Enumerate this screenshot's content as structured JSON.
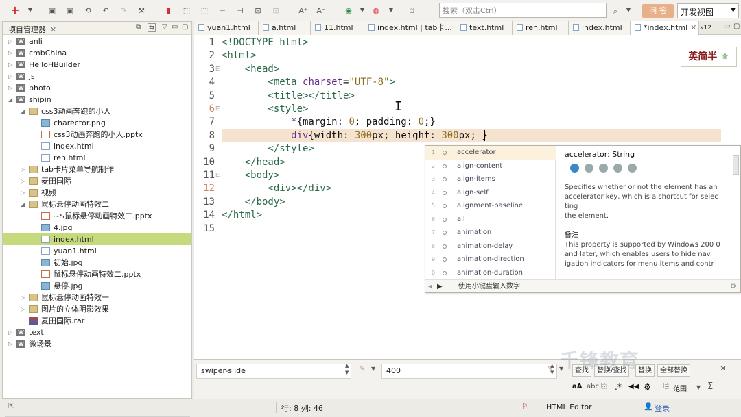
{
  "toolbar": {
    "search_placeholder": "搜索（双击Ctrl）",
    "ask_label": "问 答",
    "view_label": "开发视图"
  },
  "project_panel": {
    "title": "项目管理器",
    "tree": [
      {
        "label": "anli",
        "depth": 0,
        "icon": "web-project-icon",
        "twisty": "closed"
      },
      {
        "label": "cmbChina",
        "depth": 0,
        "icon": "web-project-icon",
        "twisty": "closed"
      },
      {
        "label": "HelloHBuilder",
        "depth": 0,
        "icon": "web-project-icon",
        "twisty": "closed"
      },
      {
        "label": "js",
        "depth": 0,
        "icon": "web-project-icon",
        "twisty": "closed"
      },
      {
        "label": "photo",
        "depth": 0,
        "icon": "web-project-icon",
        "twisty": "closed"
      },
      {
        "label": "shipin",
        "depth": 0,
        "icon": "web-project-icon",
        "twisty": "open"
      },
      {
        "label": "css3动画奔跑的小人",
        "depth": 1,
        "icon": "folder-icon",
        "twisty": "open"
      },
      {
        "label": "charector.png",
        "depth": 2,
        "icon": "image-file-icon",
        "twisty": ""
      },
      {
        "label": "css3动画奔跑的小人.pptx",
        "depth": 2,
        "icon": "pptx-file-icon",
        "twisty": ""
      },
      {
        "label": "index.html",
        "depth": 2,
        "icon": "html-file-icon",
        "twisty": ""
      },
      {
        "label": "ren.html",
        "depth": 2,
        "icon": "html-file-icon",
        "twisty": ""
      },
      {
        "label": "tab卡片菜单导航制作",
        "depth": 1,
        "icon": "folder-icon",
        "twisty": "closed"
      },
      {
        "label": "麦田国际",
        "depth": 1,
        "icon": "folder-icon",
        "twisty": "closed"
      },
      {
        "label": "视频",
        "depth": 1,
        "icon": "folder-icon",
        "twisty": "closed"
      },
      {
        "label": "鼠标悬停动画特效二",
        "depth": 1,
        "icon": "folder-icon",
        "twisty": "open"
      },
      {
        "label": "~$鼠标悬停动画特效二.pptx",
        "depth": 2,
        "icon": "pptx-file-icon",
        "twisty": ""
      },
      {
        "label": "4.jpg",
        "depth": 2,
        "icon": "image-file-icon",
        "twisty": ""
      },
      {
        "label": "index.html",
        "depth": 2,
        "icon": "html-file-icon",
        "twisty": "",
        "selected": true
      },
      {
        "label": "yuan1.html",
        "depth": 2,
        "icon": "html-file-icon",
        "twisty": ""
      },
      {
        "label": "初始.jpg",
        "depth": 2,
        "icon": "image-file-icon",
        "twisty": ""
      },
      {
        "label": "鼠标悬停动画特效二.pptx",
        "depth": 2,
        "icon": "pptx-file-icon",
        "twisty": ""
      },
      {
        "label": "悬停.jpg",
        "depth": 2,
        "icon": "image-file-icon",
        "twisty": ""
      },
      {
        "label": "鼠标悬停动画特效一",
        "depth": 1,
        "icon": "folder-icon",
        "twisty": "closed"
      },
      {
        "label": "图片的立体阴影效果",
        "depth": 1,
        "icon": "folder-icon",
        "twisty": "closed"
      },
      {
        "label": "麦田国际.rar",
        "depth": 1,
        "icon": "rar-file-icon",
        "twisty": ""
      },
      {
        "label": "text",
        "depth": 0,
        "icon": "web-project-icon",
        "twisty": "closed"
      },
      {
        "label": "微场景",
        "depth": 0,
        "icon": "web-project-icon",
        "twisty": "closed"
      }
    ]
  },
  "tabs": [
    {
      "label": "yuan1.html"
    },
    {
      "label": "a.html"
    },
    {
      "label": "11.html"
    },
    {
      "label": "index.html | tab卡..."
    },
    {
      "label": "text.html"
    },
    {
      "label": "ren.html"
    },
    {
      "label": "index.html"
    },
    {
      "label": "*index.html",
      "close": "✕",
      "active": true
    }
  ],
  "tabs_overflow": "»12",
  "editor": {
    "line_numbers": [
      "1",
      "2",
      "3",
      "4",
      "5",
      "6",
      "7",
      "8",
      "9",
      "10",
      "11",
      "12",
      "13",
      "14",
      "15"
    ],
    "lines": [
      [
        {
          "t": "<!DOCTYPE html>",
          "c": "t-tag"
        }
      ],
      [
        {
          "t": "<html>",
          "c": "t-tag"
        }
      ],
      [
        {
          "t": "    <head>",
          "c": "t-tag"
        }
      ],
      [
        {
          "t": "        <meta ",
          "c": "t-tag"
        },
        {
          "t": "charset",
          "c": "t-attr"
        },
        {
          "t": "=",
          "c": "t-prop"
        },
        {
          "t": "\"UTF-8\"",
          "c": "t-str"
        },
        {
          "t": ">",
          "c": "t-tag"
        }
      ],
      [
        {
          "t": "        <title></title>",
          "c": "t-tag"
        }
      ],
      [
        {
          "t": "        <style>",
          "c": "t-tag"
        }
      ],
      [
        {
          "t": "            *",
          "c": "t-sel"
        },
        {
          "t": "{margin: ",
          "c": "t-prop"
        },
        {
          "t": "0",
          "c": "t-num"
        },
        {
          "t": "; padding: ",
          "c": "t-prop"
        },
        {
          "t": "0",
          "c": "t-num"
        },
        {
          "t": ";}",
          "c": "t-prop"
        }
      ],
      [
        {
          "t": "            div",
          "c": "t-sel"
        },
        {
          "t": "{width: ",
          "c": "t-prop"
        },
        {
          "t": "300",
          "c": "t-num"
        },
        {
          "t": "px; height: ",
          "c": "t-prop"
        },
        {
          "t": "300",
          "c": "t-num"
        },
        {
          "t": "px; }",
          "c": "t-prop"
        }
      ],
      [
        {
          "t": "        </style>",
          "c": "t-tag"
        }
      ],
      [
        {
          "t": "    </head>",
          "c": "t-tag"
        }
      ],
      [
        {
          "t": "    <body>",
          "c": "t-tag"
        }
      ],
      [
        {
          "t": "        <div></div>",
          "c": "t-tag"
        }
      ],
      [
        {
          "t": "    </body>",
          "c": "t-tag"
        }
      ],
      [
        {
          "t": "</html>",
          "c": "t-tag"
        }
      ],
      []
    ]
  },
  "brand_logo": "英简半",
  "autocomplete": {
    "items": [
      {
        "n": "1",
        "label": "accelerator",
        "selected": true
      },
      {
        "n": "2",
        "label": "align-content"
      },
      {
        "n": "3",
        "label": "align-items"
      },
      {
        "n": "4",
        "label": "align-self"
      },
      {
        "n": "5",
        "label": "alignment-baseline"
      },
      {
        "n": "6",
        "label": "all"
      },
      {
        "n": "7",
        "label": "animation"
      },
      {
        "n": "8",
        "label": "animation-delay"
      },
      {
        "n": "9",
        "label": "animation-direction"
      },
      {
        "n": "0",
        "label": "animation-duration"
      }
    ],
    "doc_title": "accelerator: String",
    "doc_body_1": "Specifies whether or not the element has an accelerator key, which is a shortcut for selec ting",
    "doc_body_2": "the element.",
    "note_title": "备注",
    "note_body": "This property is supported by Windows 200 0 and later, which enables users to hide nav igation indicators for menu items and contr",
    "footer_hint": "使用小键盘输入数字"
  },
  "bottom_panel": {
    "field1_value": "swiper-slide",
    "field2_value": "400",
    "find_buttons": [
      "查找",
      "替换/查找",
      "替换",
      "全部替换"
    ],
    "scope_label": "范围"
  },
  "watermark": "千锋教育",
  "statusbar": {
    "position": "行: 8 列: 46",
    "editor_mode": "HTML Editor",
    "login": "登录"
  }
}
